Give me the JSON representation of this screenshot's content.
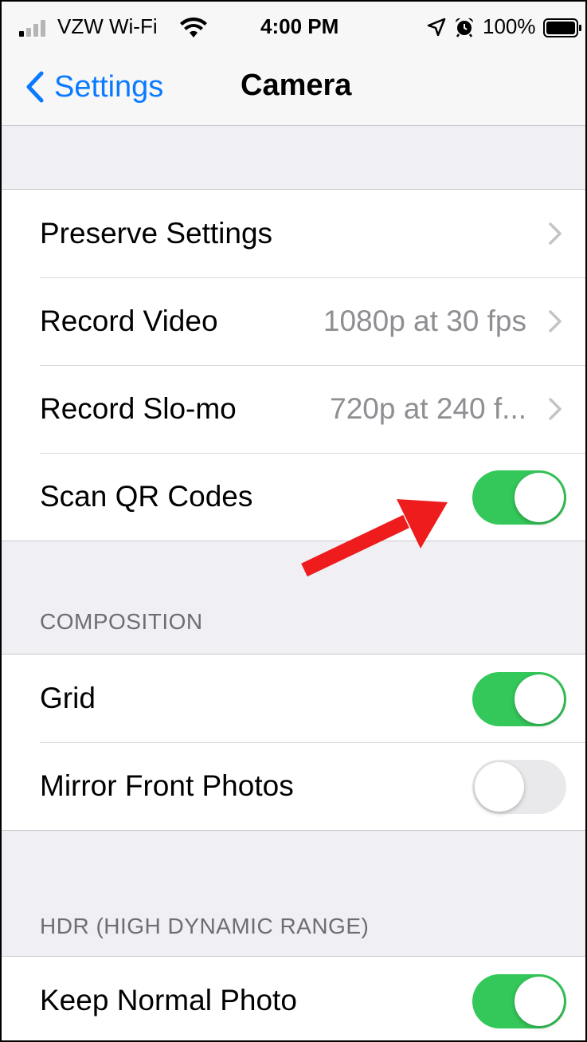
{
  "status_bar": {
    "carrier": "VZW Wi-Fi",
    "time": "4:00 PM",
    "battery": "100%",
    "icons": [
      "signal-icon",
      "wifi-icon",
      "location-icon",
      "alarm-icon",
      "battery-icon"
    ]
  },
  "nav": {
    "back_label": "Settings",
    "title": "Camera"
  },
  "groups": {
    "main": {
      "rows": [
        {
          "label": "Preserve Settings",
          "value": "",
          "type": "disclosure"
        },
        {
          "label": "Record Video",
          "value": "1080p at 30 fps",
          "type": "disclosure"
        },
        {
          "label": "Record Slo-mo",
          "value": "720p at 240 f...",
          "type": "disclosure"
        },
        {
          "label": "Scan QR Codes",
          "type": "toggle",
          "on": true
        }
      ]
    },
    "composition": {
      "header": "COMPOSITION",
      "rows": [
        {
          "label": "Grid",
          "type": "toggle",
          "on": true
        },
        {
          "label": "Mirror Front Photos",
          "type": "toggle",
          "on": false
        }
      ]
    },
    "hdr": {
      "header": "HDR (HIGH DYNAMIC RANGE)",
      "rows": [
        {
          "label": "Keep Normal Photo",
          "type": "toggle",
          "on": true
        }
      ]
    }
  },
  "colors": {
    "accent": "#0a7aff",
    "toggle_on": "#34c759",
    "toggle_off": "#e9e9eb",
    "annotation_arrow": "#ee1c1c",
    "background": "#efeff4"
  }
}
